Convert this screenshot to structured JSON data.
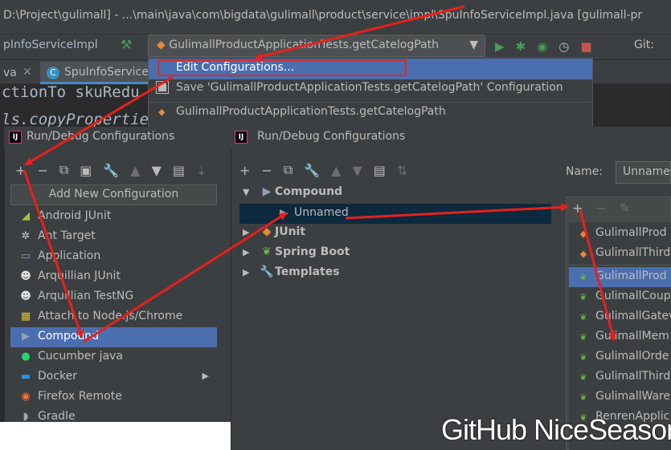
{
  "ide": {
    "title": "D:\\Project\\gulimall] - ...\\main\\java\\com\\bigdata\\gulimall\\product\\service\\impl\\SpuInfoServiceImpl.java [gulimall-pr",
    "nav_class": "pInfoServiceImpl",
    "run_config": "GulimallProductApplicationTests.getCatelogPath",
    "git_label": "Git:",
    "tabs": [
      "va",
      "SpuInfoService"
    ],
    "tab_spu_icon": "C",
    "code_line1": "ctionTo skuRedu",
    "code_line2": "ls.copyPropertie"
  },
  "run_menu": {
    "items": [
      "Edit Configurations...",
      "Save 'GulimallProductApplicationTests.getCatelogPath' Configuration",
      "GulimallProductApplicationTests.getCatelogPath"
    ]
  },
  "dialog_left": {
    "title": "Run/Debug Configurations",
    "add_new_header": "Add New Configuration",
    "items": [
      {
        "label": "Android JUnit",
        "icon": "android-icon"
      },
      {
        "label": "Ant Target",
        "icon": "ant-icon"
      },
      {
        "label": "Application",
        "icon": "application-icon"
      },
      {
        "label": "Arquillian JUnit",
        "icon": "arquillian-icon"
      },
      {
        "label": "Arquillian TestNG",
        "icon": "arquillian-icon"
      },
      {
        "label": "Attach to Node.js/Chrome",
        "icon": "nodejs-icon"
      },
      {
        "label": "Compound",
        "icon": "compound-icon"
      },
      {
        "label": "Cucumber java",
        "icon": "cucumber-icon"
      },
      {
        "label": "Docker",
        "icon": "docker-icon"
      },
      {
        "label": "Firefox Remote",
        "icon": "firefox-icon"
      },
      {
        "label": "Gradle",
        "icon": "gradle-icon"
      }
    ],
    "selected_index": 6
  },
  "dialog_right": {
    "title": "Run/Debug Configurations",
    "name_label": "Name:",
    "name_value": "Unname",
    "tree": [
      {
        "label": "Compound",
        "expanded": true
      },
      {
        "label": "Unnamed"
      },
      {
        "label": "JUnit"
      },
      {
        "label": "Spring Boot"
      },
      {
        "label": "Templates"
      }
    ],
    "compound_list_top": [
      "GulimallProd",
      "GulimallThird"
    ],
    "compound_list_bottom": [
      "GulimallProd",
      "GulimallCoup",
      "GulimallGatev",
      "GulimallMem",
      "GulimallOrde",
      "GulimallThird",
      "GulimallWare",
      "RenrenApplic"
    ]
  },
  "watermark": "GitHub NiceSeason",
  "colors": {
    "selection": "#4b6eaf",
    "highlight_box": "#d62b2b",
    "arrow": "#e8201b"
  }
}
